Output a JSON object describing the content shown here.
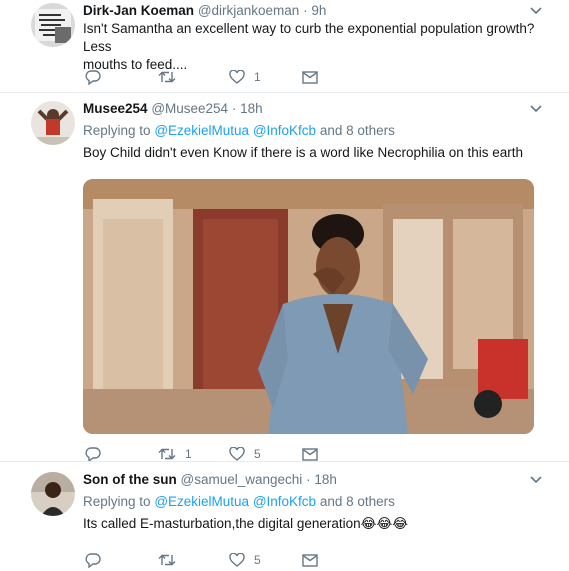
{
  "tweets": [
    {
      "name": "Dirk-Jan Koeman",
      "handle": "@dirkjankoeman",
      "time": "9h",
      "text_line1": "Isn't Samantha an excellent way to curb the exponential population growth? Less",
      "text_line2": "mouths to feed....",
      "reply_count": "",
      "retweet_count": "",
      "like_count": "1"
    },
    {
      "name": "Musee254",
      "handle": "@Musee254",
      "time": "18h",
      "replying_label": "Replying to",
      "mention1": "@EzekielMutua",
      "mention2": "@InfoKfcb",
      "others": "and 8 others",
      "text": "Boy Child didn't even Know if there is a word like Necrophilia on this earth",
      "reply_count": "",
      "retweet_count": "1",
      "like_count": "5"
    },
    {
      "name": "Son of the sun",
      "handle": "@samuel_wangechi",
      "time": "18h",
      "replying_label": "Replying to",
      "mention1": "@EzekielMutua",
      "mention2": "@InfoKfcb",
      "others": "and 8 others",
      "text": "Its called E-masturbation,the digital generation",
      "emoji": "😂😂😂",
      "reply_count": "",
      "retweet_count": "",
      "like_count": "5"
    }
  ],
  "icons": {
    "reply": "reply-icon",
    "retweet": "retweet-icon",
    "like": "heart-icon",
    "dm": "envelope-icon",
    "more": "chevron-down-icon"
  },
  "colors": {
    "link": "#1da1f2",
    "secondary": "#657786",
    "divider": "#e6ecf0"
  }
}
